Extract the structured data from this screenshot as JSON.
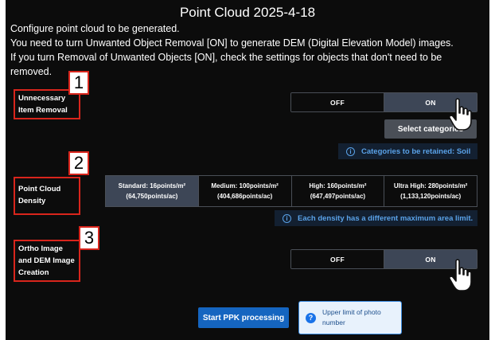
{
  "header": {
    "title": "Point Cloud 2025-4-18"
  },
  "intro": {
    "line1": "Configure point cloud to be generated.",
    "line2": "You need to turn Unwanted Object Removal [ON] to generate DEM (Digital Elevation Model) images.",
    "line3": "If you turn Removal of Unwanted Objects [ON], check the settings for objects that don't need to be removed."
  },
  "sections": {
    "removal": {
      "number": "1",
      "label_line1": "Unnecessary",
      "label_line2": "Item Removal",
      "toggle": {
        "off": "OFF",
        "on": "ON",
        "selected": "ON"
      },
      "select_button": "Select categories",
      "info": "Categories to be retained: Soil"
    },
    "density": {
      "number": "2",
      "label_line1": "Point Cloud",
      "label_line2": "Density",
      "options": [
        {
          "line1": "Standard: 16points/m²",
          "line2": "(64,750points/ac)"
        },
        {
          "line1": "Medium: 100points/m²",
          "line2": "(404,686points/ac)"
        },
        {
          "line1": "High: 160points/m²",
          "line2": "(647,497points/ac)"
        },
        {
          "line1": "Ultra High: 280points/m²",
          "line2": "(1,133,120points/ac)"
        }
      ],
      "selected": "Standard: 16points/m²",
      "info": "Each density has a different maximum area limit."
    },
    "ortho": {
      "number": "3",
      "label_line1": "Ortho Image",
      "label_line2": "and DEM Image",
      "label_line3": "Creation",
      "toggle": {
        "off": "OFF",
        "on": "ON",
        "selected": "ON"
      }
    }
  },
  "footer": {
    "ppk_button": "Start PPK processing",
    "tooltip_line1": "Upper limit of photo",
    "tooltip_line2": "number"
  },
  "icons": {
    "info": "info-circle-icon",
    "help": "question-circle-icon",
    "cursor": "hand-pointer-icon"
  },
  "colors": {
    "background": "#0c0c0c",
    "highlight": "#d9251c",
    "selected": "#3d4656",
    "accent": "#1565c0",
    "info_text": "#5aa2e8"
  }
}
